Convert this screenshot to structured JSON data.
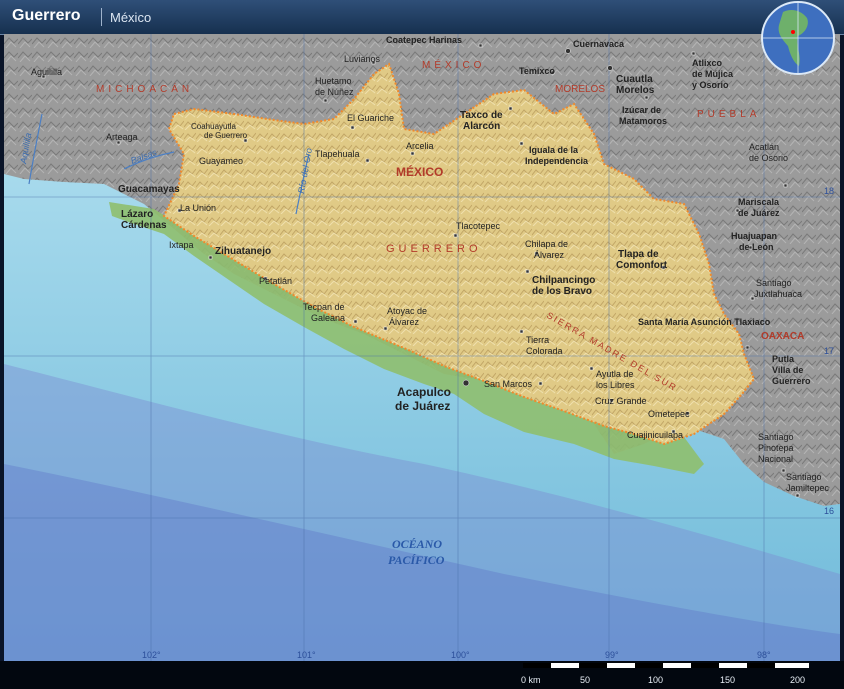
{
  "header": {
    "title": "Guerrero",
    "subtitle": "México"
  },
  "map": {
    "regions": [
      {
        "label": "MICHOACÁN"
      },
      {
        "label": "MÉXICO"
      },
      {
        "label": "MORELOS"
      },
      {
        "label": "PUEBLA"
      },
      {
        "label": "OAXACA"
      },
      {
        "label": "MÉXICO"
      },
      {
        "label": "GUERRERO"
      },
      {
        "label": "SIERRA MADRE DEL SUR"
      }
    ],
    "rivers": [
      {
        "label": "Aquililla"
      },
      {
        "label": "Balsas"
      },
      {
        "label": "Río del Oro"
      }
    ],
    "ocean": {
      "line1": "OCÉANO",
      "line2": "PACÍFICO"
    },
    "cities": [
      {
        "label": "Aguililla"
      },
      {
        "label": "Arteaga"
      },
      {
        "label": "Guacamayas"
      },
      {
        "label": "Lázaro"
      },
      {
        "label": "Cárdenas"
      },
      {
        "label": "La Unión"
      },
      {
        "label": "Ixtapa"
      },
      {
        "label": "Zihuatanejo"
      },
      {
        "label": "Petatlán"
      },
      {
        "label": "Coahuayutla"
      },
      {
        "label": "de Guerrero"
      },
      {
        "label": "Guayameo"
      },
      {
        "label": "Huetamo"
      },
      {
        "label": "de Núñez"
      },
      {
        "label": "Luvianos"
      },
      {
        "label": "El Guariche"
      },
      {
        "label": "Tlapehuala"
      },
      {
        "label": "Arcelia"
      },
      {
        "label": "Coatepec Harinas"
      },
      {
        "label": "Cuernavaca"
      },
      {
        "label": "Temixco"
      },
      {
        "label": "Cuautla"
      },
      {
        "label": "Morelos"
      },
      {
        "label": "Atlixco"
      },
      {
        "label": "de Mújica"
      },
      {
        "label": "y Osorio"
      },
      {
        "label": "Izúcar de"
      },
      {
        "label": "Matamoros"
      },
      {
        "label": "Taxco de"
      },
      {
        "label": "Alarcón"
      },
      {
        "label": "Iguala de la"
      },
      {
        "label": "Independencia"
      },
      {
        "label": "Acatlán"
      },
      {
        "label": "de Osorio"
      },
      {
        "label": "Mariscala"
      },
      {
        "label": "de Juárez"
      },
      {
        "label": "Huajuapan"
      },
      {
        "label": "de León"
      },
      {
        "label": "Tlacotepec"
      },
      {
        "label": "Chilapa de"
      },
      {
        "label": "Álvarez"
      },
      {
        "label": "Chilpancingo"
      },
      {
        "label": "de los Bravo"
      },
      {
        "label": "Tlapa de"
      },
      {
        "label": "Comonfort"
      },
      {
        "label": "Santiago"
      },
      {
        "label": "Juxtlahuaca"
      },
      {
        "label": "Santa María Asunción Tlaxiaco"
      },
      {
        "label": "Tecpan de"
      },
      {
        "label": "Galeana"
      },
      {
        "label": "Atoyac de"
      },
      {
        "label": "Álvarez"
      },
      {
        "label": "Tierra"
      },
      {
        "label": "Colorada"
      },
      {
        "label": "Putla"
      },
      {
        "label": "Villa de"
      },
      {
        "label": "Guerrero"
      },
      {
        "label": "Acapulco"
      },
      {
        "label": "de Juárez"
      },
      {
        "label": "San Marcos"
      },
      {
        "label": "Ayutla de"
      },
      {
        "label": "los Libres"
      },
      {
        "label": "Cruz Grande"
      },
      {
        "label": "Ometepec"
      },
      {
        "label": "Cuajinicuilapa"
      },
      {
        "label": "Santiago"
      },
      {
        "label": "Pinotepa"
      },
      {
        "label": "Nacional"
      },
      {
        "label": "Santiago"
      },
      {
        "label": "Jamiltepec"
      }
    ],
    "longitudes": [
      "102°",
      "101°",
      "100°",
      "99°",
      "98°"
    ],
    "latitudes": [
      "18",
      "17",
      "16"
    ],
    "scale": {
      "ticks": [
        "0 km",
        "50",
        "100",
        "150",
        "200"
      ]
    },
    "colors": {
      "ocean": "#8fd0ea",
      "land": "#9a9a9a",
      "state": "#e3cd8c",
      "border": "#f08a2c"
    }
  }
}
